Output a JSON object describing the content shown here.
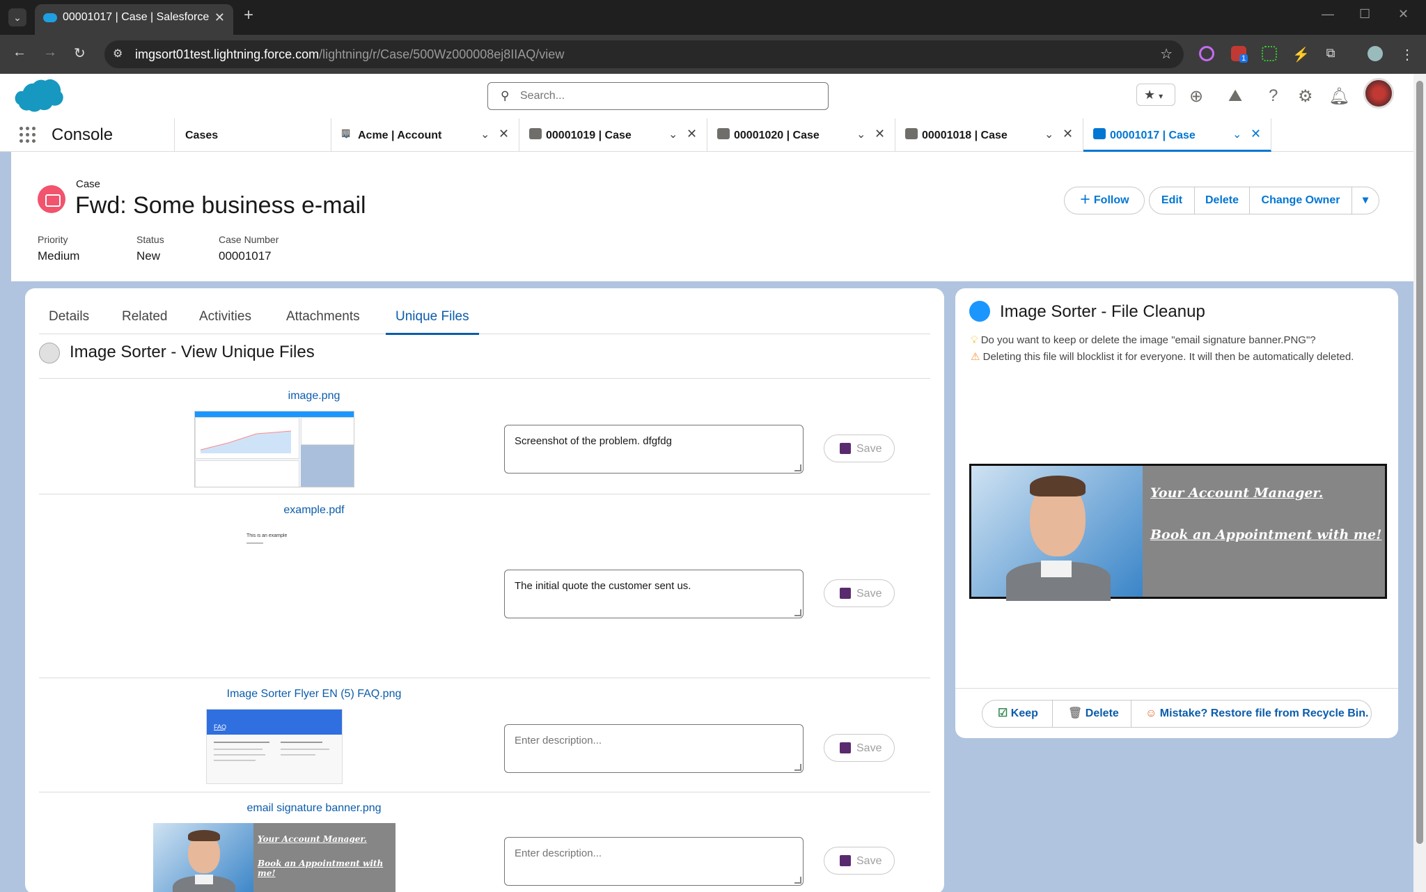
{
  "browser": {
    "tab_title": "00001017 | Case | Salesforce",
    "url_host": "imgsort01test.lightning.force.com",
    "url_path": "/lightning/r/Case/500Wz000008ej8IIAQ/view",
    "ext_badge": "1"
  },
  "header": {
    "search_placeholder": "Search..."
  },
  "console": {
    "app_name": "Console",
    "nav_item": "Cases",
    "tabs": [
      {
        "label": "Acme | Account"
      },
      {
        "label": "00001019 | Case"
      },
      {
        "label": "00001020 | Case"
      },
      {
        "label": "00001018 | Case"
      },
      {
        "label": "00001017 | Case"
      }
    ]
  },
  "record": {
    "object_label": "Case",
    "title": "Fwd: Some business e-mail",
    "fields": [
      {
        "label": "Priority",
        "value": "Medium"
      },
      {
        "label": "Status",
        "value": "New"
      },
      {
        "label": "Case Number",
        "value": "00001017"
      }
    ],
    "actions": {
      "follow": "Follow",
      "edit": "Edit",
      "delete": "Delete",
      "change_owner": "Change Owner"
    }
  },
  "detail_tabs": [
    "Details",
    "Related",
    "Activities",
    "Attachments",
    "Unique Files"
  ],
  "unique_files": {
    "title": "Image Sorter - View Unique Files",
    "save_label": "Save",
    "placeholder": "Enter description...",
    "files": [
      {
        "name": "image.png",
        "description": "Screenshot of the problem. dfgfdg"
      },
      {
        "name": "example.pdf",
        "description": "The initial quote the customer sent us.",
        "preview_text": "This is an example"
      },
      {
        "name": "Image Sorter Flyer EN (5) FAQ.png",
        "description": "",
        "preview_text": "FAQ"
      },
      {
        "name": "email signature banner.png",
        "description": ""
      }
    ]
  },
  "banner": {
    "line1": "Your Account Manager.",
    "line2": "Book an Appointment with me!"
  },
  "cleanup": {
    "title": "Image Sorter - File Cleanup",
    "question": "Do you want to keep or delete the image \"email signature banner.PNG\"?",
    "warning": "Deleting this file will blocklist it for everyone. It will then be automatically deleted.",
    "keep": "Keep",
    "delete": "Delete",
    "restore": "Mistake? Restore file from Recycle Bin."
  }
}
